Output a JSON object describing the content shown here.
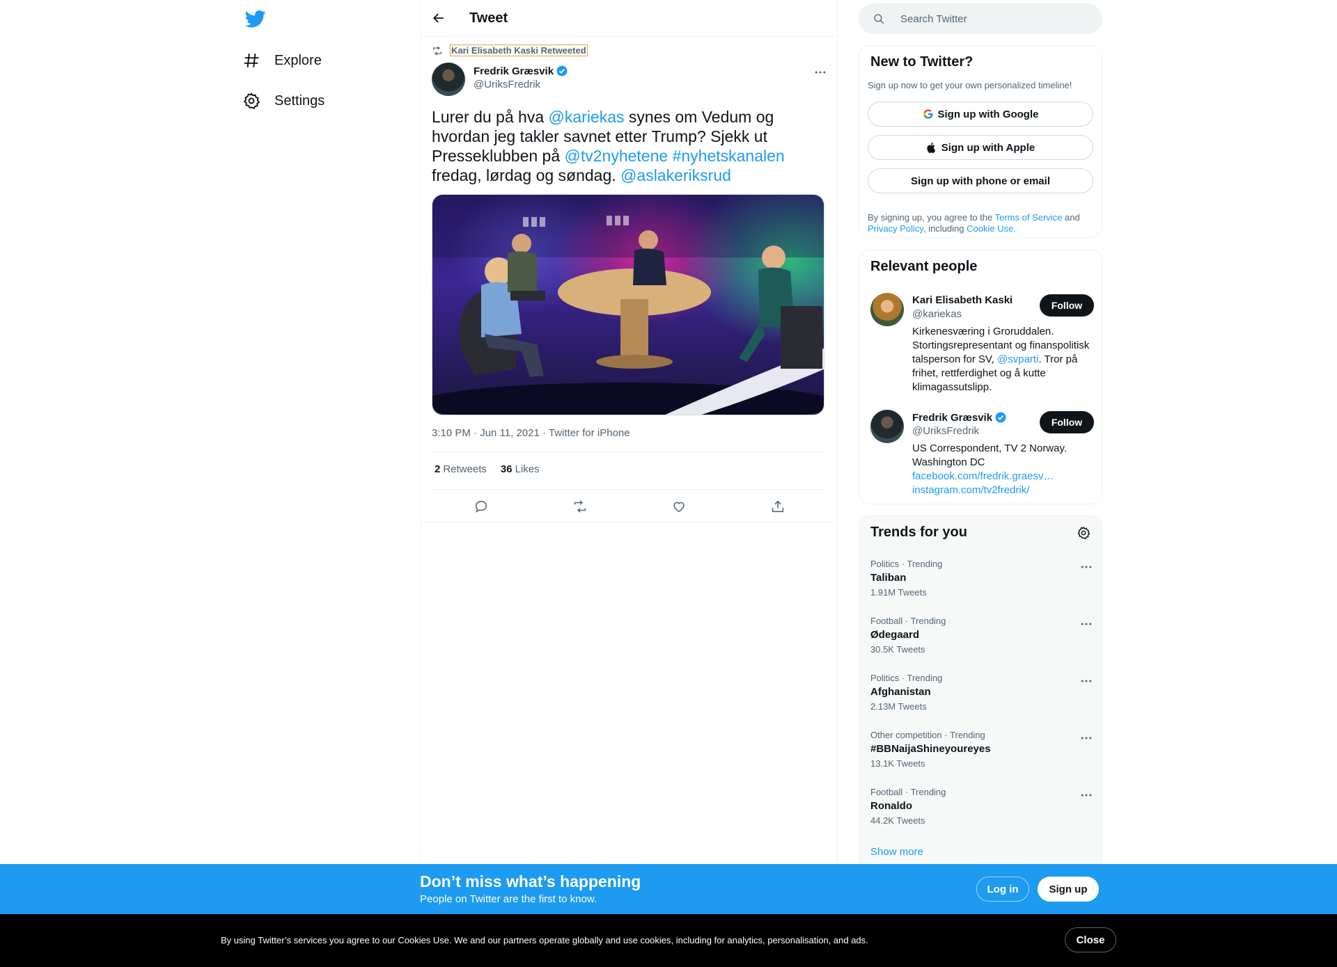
{
  "nav": {
    "items": [
      {
        "label": "Explore",
        "icon": "hashtag-icon"
      },
      {
        "label": "Settings",
        "icon": "gear-icon"
      }
    ]
  },
  "header": {
    "title": "Tweet"
  },
  "tweet": {
    "retweeted_by": "Kari Elisabeth Kaski Retweeted",
    "author_name": "Fredrik Græsvik",
    "author_handle": "@UriksFredrik",
    "text_parts": {
      "t1": "Lurer du på hva ",
      "m1": "@kariekas",
      "t2": " synes om Vedum og hvordan jeg takler savnet etter Trump? Sjekk ut Presseklubben på ",
      "m2": "@tv2nyhetene",
      "t3": " ",
      "h1": "#nyhetskanalen",
      "t4": " fredag, lørdag og søndag. ",
      "m3": "@aslakeriksrud"
    },
    "timestamp": "3:10 PM · Jun 11, 2021 · Twitter for iPhone",
    "retweets_count": "2",
    "retweets_label": "Retweets",
    "likes_count": "36",
    "likes_label": "Likes"
  },
  "search": {
    "placeholder": "Search Twitter"
  },
  "signup_card": {
    "title": "New to Twitter?",
    "subtitle": "Sign up now to get your own personalized timeline!",
    "google": "Sign up with Google",
    "apple": "Sign up with Apple",
    "phone": "Sign up with phone or email",
    "legal_1": "By signing up, you agree to the ",
    "terms": "Terms of Service",
    "legal_2": " and ",
    "privacy": "Privacy Policy",
    "legal_3": ", including ",
    "cookie": "Cookie Use."
  },
  "relevant": {
    "title": "Relevant people",
    "people": [
      {
        "name": "Kari Elisabeth Kaski",
        "handle": "@kariekas",
        "bio_1": "Kirkenesværing i Groruddalen. Stortingsrepresentant og finanspolitisk talsperson for SV, ",
        "bio_link": "@svparti",
        "bio_2": ". Tror på frihet, rettferdighet og å kutte klimagassutslipp.",
        "follow": "Follow"
      },
      {
        "name": "Fredrik Græsvik",
        "handle": "@UriksFredrik",
        "bio_1": "US Correspondent, TV 2 Norway. Washington DC",
        "link_1": "facebook.com/fredrik.graesv…",
        "link_2": "instagram.com/tv2fredrik/",
        "follow": "Follow"
      }
    ]
  },
  "trends": {
    "title": "Trends for you",
    "items": [
      {
        "meta": "Politics · Trending",
        "name": "Taliban",
        "count": "1.91M Tweets"
      },
      {
        "meta": "Football · Trending",
        "name": "Ødegaard",
        "count": "30.5K Tweets"
      },
      {
        "meta": "Politics · Trending",
        "name": "Afghanistan",
        "count": "2.13M Tweets"
      },
      {
        "meta": "Other competition · Trending",
        "name": "#BBNaijaShineyoureyes",
        "count": "13.1K Tweets"
      },
      {
        "meta": "Football · Trending",
        "name": "Ronaldo",
        "count": "44.2K Tweets"
      }
    ],
    "show_more": "Show more"
  },
  "banner": {
    "title": "Don’t miss what’s happening",
    "subtitle": "People on Twitter are the first to know.",
    "login": "Log in",
    "signup": "Sign up"
  },
  "cookie_bar": {
    "text": "By using Twitter’s services you agree to our Cookies Use. We and our partners operate globally and use cookies, including for analytics, personalisation, and ads.",
    "close": "Close"
  },
  "colors": {
    "accent": "#1d9bf0",
    "text": "#0f1419",
    "muted": "#536471",
    "border": "#eff3f4"
  }
}
